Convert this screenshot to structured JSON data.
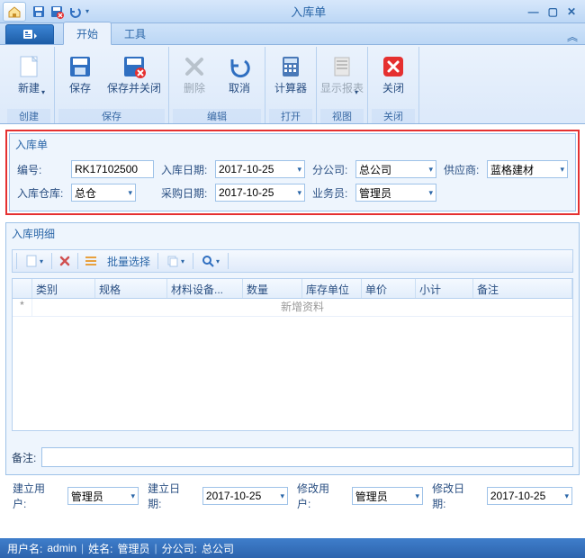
{
  "window": {
    "title": "入库单"
  },
  "ribbon": {
    "tabs": {
      "start": "开始",
      "tools": "工具"
    },
    "buttons": {
      "new": "新建",
      "save": "保存",
      "save_close": "保存并关闭",
      "delete": "删除",
      "cancel": "取消",
      "calculator": "计算器",
      "show_report": "显示报表",
      "close": "关闭"
    },
    "groups": {
      "create": "创建",
      "save": "保存",
      "edit": "编辑",
      "open": "打开",
      "view": "视图",
      "close": "关闭"
    }
  },
  "form": {
    "panel_title": "入库单",
    "labels": {
      "code": "编号:",
      "in_date": "入库日期:",
      "branch": "分公司:",
      "supplier": "供应商:",
      "warehouse": "入库仓库:",
      "purchase_date": "采购日期:",
      "operator": "业务员:"
    },
    "values": {
      "code": "RK17102500",
      "in_date": "2017-10-25",
      "branch": "总公司",
      "supplier": "蓝格建材",
      "warehouse": "总仓",
      "purchase_date": "2017-10-25",
      "operator": "管理员"
    }
  },
  "detail": {
    "title": "入库明细",
    "batch_select": "批量选择",
    "columns": [
      "类别",
      "规格",
      "材料设备...",
      "数量",
      "库存单位",
      "单价",
      "小计",
      "备注"
    ],
    "new_row": "新增资料"
  },
  "remarks": {
    "label": "备注:",
    "value": ""
  },
  "footer": {
    "labels": {
      "create_user": "建立用户:",
      "create_date": "建立日期:",
      "modify_user": "修改用户:",
      "modify_date": "修改日期:"
    },
    "values": {
      "create_user": "管理员",
      "create_date": "2017-10-25",
      "modify_user": "管理员",
      "modify_date": "2017-10-25"
    }
  },
  "status": {
    "user_label": "用户名:",
    "user": "admin",
    "name_label": "姓名:",
    "name": "管理员",
    "branch_label": "分公司:",
    "branch": "总公司"
  }
}
